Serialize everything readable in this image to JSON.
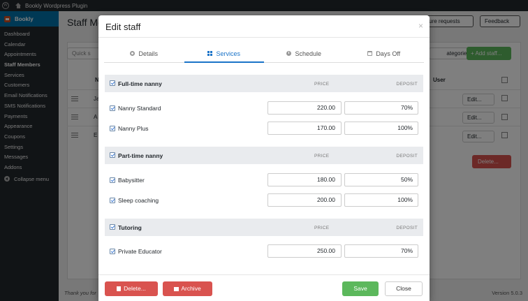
{
  "adminbar": {
    "site_name": "Bookly Wordpress Plugin",
    "wp_glyph": "W"
  },
  "sidebar": {
    "plugin": "Bookly",
    "items": [
      "Dashboard",
      "Calendar",
      "Appointments",
      "Staff Members",
      "Services",
      "Customers",
      "Email Notifications",
      "SMS Notifications",
      "Payments",
      "Appearance",
      "Coupons",
      "Settings",
      "Messages",
      "Addons"
    ],
    "active_index": 3,
    "collapse": "Collapse menu"
  },
  "background": {
    "page_title": "Staff Me",
    "feature_requests": "eature requests",
    "feedback": "Feedback",
    "quick_search": "Quick s",
    "categories": "ategories...",
    "add_staff": "+ Add staff...",
    "col_n": "N",
    "col_user": "User",
    "rows": [
      "Ja",
      "A",
      "E"
    ],
    "edit_label": "Edit...",
    "delete_label": "Delete...",
    "footer_left": "Thank you for",
    "footer_right": "Version 5.0.3"
  },
  "modal": {
    "title": "Edit staff",
    "close": "×",
    "tabs": [
      {
        "label": "Details",
        "icon": "gear-icon"
      },
      {
        "label": "Services",
        "icon": "grid-icon"
      },
      {
        "label": "Schedule",
        "icon": "clock-icon"
      },
      {
        "label": "Days Off",
        "icon": "calendar-icon"
      }
    ],
    "active_tab": 1,
    "price_header": "PRICE",
    "deposit_header": "DEPOSIT",
    "categories": [
      {
        "name": "Full-time nanny",
        "services": [
          {
            "name": "Nanny Standard",
            "price": "220.00",
            "deposit": "70%"
          },
          {
            "name": "Nanny Plus",
            "price": "170.00",
            "deposit": "100%"
          }
        ]
      },
      {
        "name": "Part-time nanny",
        "services": [
          {
            "name": "Babysitter",
            "price": "180.00",
            "deposit": "50%"
          },
          {
            "name": "Sleep coaching",
            "price": "200.00",
            "deposit": "100%"
          }
        ]
      },
      {
        "name": "Tutoring",
        "services": [
          {
            "name": "Private Educator",
            "price": "250.00",
            "deposit": "70%"
          }
        ]
      }
    ],
    "footer": {
      "delete": "Delete...",
      "archive": "Archive",
      "save": "Save",
      "close": "Close"
    }
  }
}
